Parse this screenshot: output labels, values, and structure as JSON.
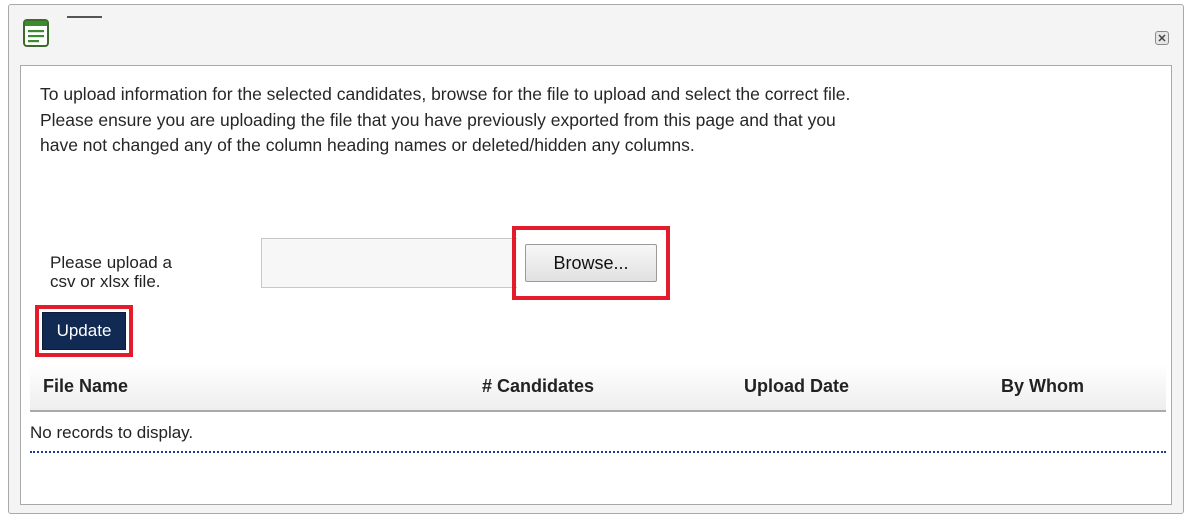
{
  "window": {
    "title": "",
    "icon": "document-list-icon",
    "close_icon": "close-icon"
  },
  "instructions": {
    "line1": "To upload information for the selected candidates, browse for the file to upload and select the correct file.",
    "line2": "Please ensure you are uploading the file that you have previously exported from this page and that you",
    "line3": "have not changed any of the column heading names or deleted/hidden any columns."
  },
  "upload": {
    "label_line1": "Please upload a",
    "label_line2": "csv or xlsx file.",
    "file_value": "",
    "browse_label": "Browse...",
    "update_label": "Update"
  },
  "grid": {
    "columns": [
      "File Name",
      "# Candidates",
      "Upload Date",
      "By Whom"
    ],
    "empty_text": "No records to display."
  },
  "colors": {
    "highlight": "#e21c2a",
    "update_bg": "#102a54",
    "dotted_line": "#1b3f8f"
  }
}
